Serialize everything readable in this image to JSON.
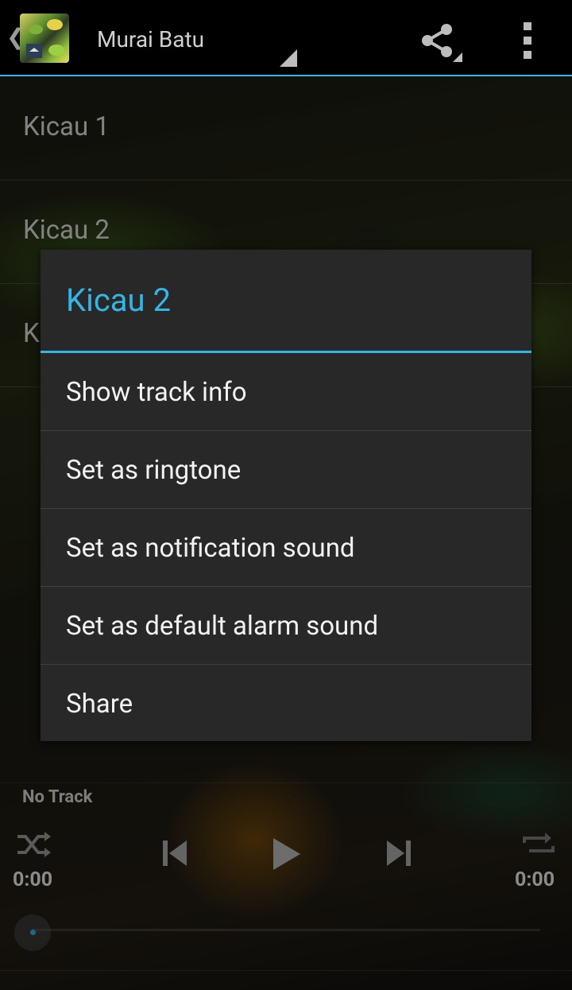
{
  "action_bar": {
    "title": "Murai Batu",
    "icons": {
      "up": "chevron-left-icon",
      "share": "share-icon",
      "overflow": "more-vert-icon"
    }
  },
  "tracks": [
    {
      "label": "Kicau 1"
    },
    {
      "label": "Kicau 2"
    },
    {
      "label": "K"
    }
  ],
  "player": {
    "now_playing": "No Track",
    "time_elapsed": "0:00",
    "time_total": "0:00",
    "icons": [
      "shuffle-icon",
      "previous-icon",
      "play-icon",
      "next-icon",
      "repeat-icon"
    ]
  },
  "dialog": {
    "title": "Kicau 2",
    "items": [
      {
        "label": "Show track info"
      },
      {
        "label": "Set as ringtone"
      },
      {
        "label": "Set as notification sound"
      },
      {
        "label": "Set as default alarm sound"
      },
      {
        "label": "Share"
      }
    ]
  },
  "colors": {
    "accent": "#33b5e5",
    "dialog_bg": "#282828",
    "action_bar_bg": "#000000"
  }
}
